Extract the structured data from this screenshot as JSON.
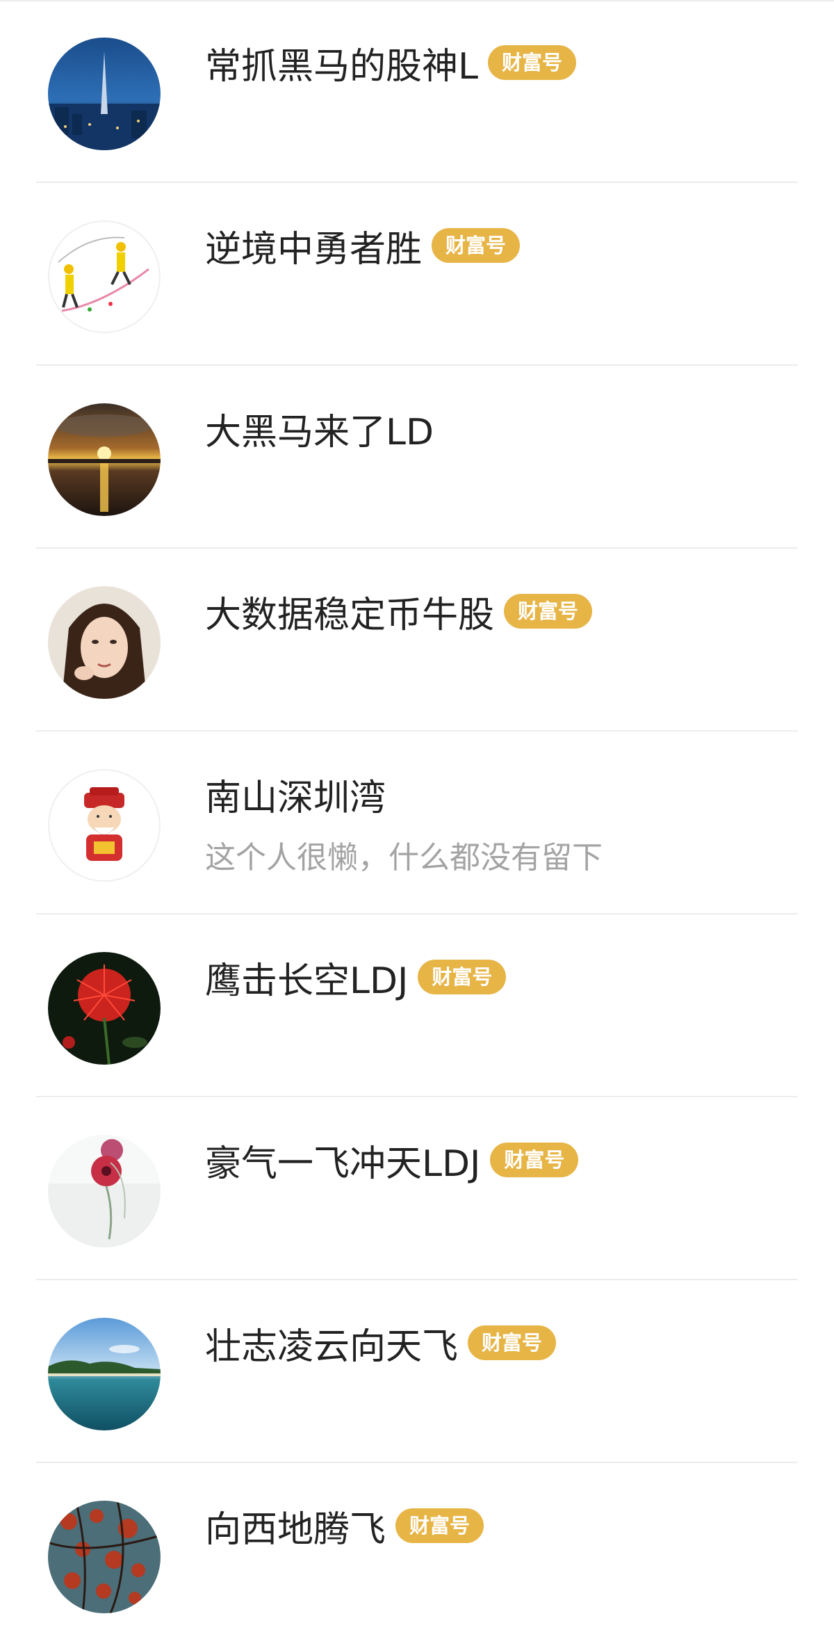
{
  "colors": {
    "badge_bg": "#e7b446",
    "badge_text": "#ffffff",
    "name_text": "#222222",
    "bio_text": "#a3a3a3",
    "divider": "#ececec"
  },
  "users": [
    {
      "name": "常抓黑马的股神L",
      "badge": "财富号",
      "bio": "",
      "avatar": "city-night-tower-avatar"
    },
    {
      "name": "逆境中勇者胜",
      "badge": "财富号",
      "bio": "",
      "avatar": "climbing-workers-cartoon-avatar"
    },
    {
      "name": "大黑马来了LD",
      "badge": "",
      "bio": "",
      "avatar": "sunset-over-water-avatar"
    },
    {
      "name": "大数据稳定币牛股",
      "badge": "财富号",
      "bio": "",
      "avatar": "woman-portrait-avatar"
    },
    {
      "name": "南山深圳湾",
      "badge": "",
      "bio": "这个人很懒，什么都没有留下",
      "avatar": "fortune-god-cartoon-avatar"
    },
    {
      "name": "鹰击长空LDJ",
      "badge": "财富号",
      "bio": "",
      "avatar": "red-flower-dark-avatar"
    },
    {
      "name": "豪气一飞冲天LDJ",
      "badge": "财富号",
      "bio": "",
      "avatar": "pink-flowers-avatar"
    },
    {
      "name": "壮志凌云向天飞",
      "badge": "财富号",
      "bio": "",
      "avatar": "tropical-island-sea-avatar"
    },
    {
      "name": "向西地腾飞",
      "badge": "财富号",
      "bio": "",
      "avatar": "autumn-leaves-avatar"
    }
  ]
}
